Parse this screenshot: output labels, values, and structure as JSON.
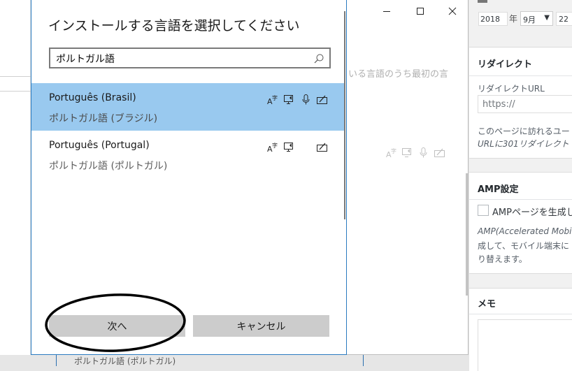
{
  "background_window": {
    "hint_text": "いる言語のうち最初の言",
    "bottom_text": "ポルトガル語 (ポルトガル)"
  },
  "wordpress": {
    "date": {
      "year": "2018",
      "year_unit": "年",
      "month": "9月",
      "day": "22"
    },
    "redirect": {
      "heading": "リダイレクト",
      "url_label": "リダイレクトURL",
      "url_placeholder": "https://",
      "desc_line1": "このページに訪れるユー",
      "desc_line2": "URLに301リダイレクト"
    },
    "amp": {
      "heading": "AMP設定",
      "checkbox_label": "AMPページを生成し",
      "desc_line1": "AMP(Accelerated Mobile",
      "desc_line2": "成して、モバイル端末に",
      "desc_line3": "り替えます。"
    },
    "memo": {
      "heading": "メモ"
    }
  },
  "dialog": {
    "title": "インストールする言語を選択してください",
    "search_value": "ポルトガル語",
    "languages": [
      {
        "name": "Português (Brasil)",
        "subtitle": "ポルトガル語 (ブラジル)",
        "selected": true,
        "features": [
          "language-pack-icon",
          "text-to-speech-icon",
          "speech-recognition-icon",
          "handwriting-icon"
        ]
      },
      {
        "name": "Português (Portugal)",
        "subtitle": "ポルトガル語 (ポルトガル)",
        "selected": false,
        "features": [
          "language-pack-icon",
          "text-to-speech-icon",
          "handwriting-icon"
        ]
      }
    ],
    "next_label": "次へ",
    "cancel_label": "キャンセル"
  },
  "colors": {
    "selection": "#99c9ef",
    "dialog_border": "#2a7bc0",
    "button": "#cccccc"
  }
}
